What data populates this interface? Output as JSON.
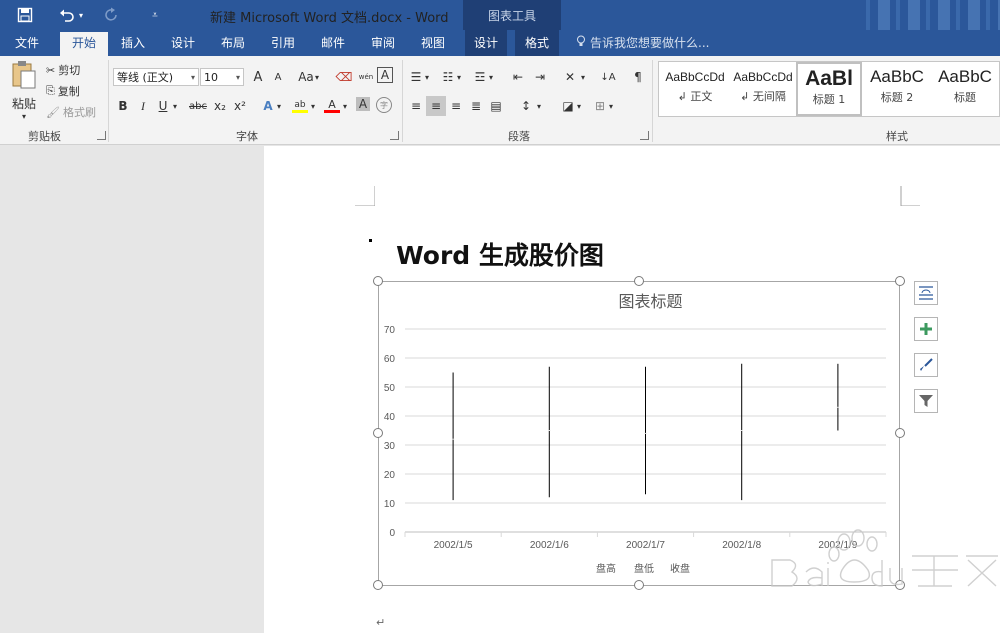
{
  "titlebar": {
    "title": "新建 Microsoft Word 文档.docx - Word",
    "contextual_tools": "图表工具",
    "save_icon": "save-icon",
    "undo_icon": "undo-icon",
    "redo_icon": "redo-icon",
    "customize_icon": "customize-quick-access-icon"
  },
  "tabs": [
    "文件",
    "开始",
    "插入",
    "设计",
    "布局",
    "引用",
    "邮件",
    "审阅",
    "视图",
    "设计",
    "格式"
  ],
  "active_tab_index": 1,
  "tell_me": "告诉我您想要做什么...",
  "clipboard": {
    "paste": "粘贴",
    "cut": "剪切",
    "copy": "复制",
    "format_painter": "格式刷",
    "group_label": "剪贴板"
  },
  "font": {
    "font_name": "等线 (正文)",
    "font_size": "10",
    "grow": "A",
    "shrink": "A",
    "change_case": "Aa",
    "phonetic": "wén",
    "border": "A",
    "bold": "B",
    "italic": "I",
    "underline": "U",
    "strike": "abc",
    "subscript": "x₂",
    "superscript": "x²",
    "effects": "A",
    "highlight": "ab",
    "color": "A",
    "shading": "A",
    "enclose": "字",
    "group_label": "字体"
  },
  "paragraph": {
    "group_label": "段落"
  },
  "styles": {
    "items": [
      {
        "sample": "AaBbCcDd",
        "name": "↲ 正文"
      },
      {
        "sample": "AaBbCcDd",
        "name": "↲ 无间隔"
      },
      {
        "sample": "AaBl",
        "name": "标题 1"
      },
      {
        "sample": "AaBbC",
        "name": "标题 2"
      },
      {
        "sample": "AaBbC",
        "name": "标题"
      }
    ],
    "selected_index": 2,
    "group_label": "样式"
  },
  "document": {
    "heading": "Word 生成股价图",
    "paragraph_mark": "↵"
  },
  "chart_data": {
    "type": "stock",
    "title": "图表标题",
    "categories": [
      "2002/1/5",
      "2002/1/6",
      "2002/1/7",
      "2002/1/8",
      "2002/1/9"
    ],
    "series": [
      {
        "name": "盘高",
        "values": [
          55,
          57,
          57,
          58,
          58
        ]
      },
      {
        "name": "盘低",
        "values": [
          11,
          12,
          13,
          11,
          35
        ]
      },
      {
        "name": "收盘",
        "values": [
          32,
          35,
          34,
          35,
          43
        ]
      }
    ],
    "legend_labels": [
      "盘高",
      "盘低",
      "收盘"
    ],
    "ylim": [
      0,
      70
    ],
    "yticks": [
      "0",
      "10",
      "20",
      "30",
      "40",
      "50",
      "60",
      "70"
    ],
    "grid": true,
    "legend_position": "bottom",
    "line_color": "#000000",
    "grid_color": "#d9d9d9"
  },
  "chart_buttons": [
    "layout-options-icon",
    "chart-elements-icon",
    "chart-styles-icon",
    "chart-filters-icon"
  ],
  "colors": {
    "accent": "#2b579a",
    "highlight_yellow": "#ffff00",
    "font_red": "#ff0000"
  }
}
